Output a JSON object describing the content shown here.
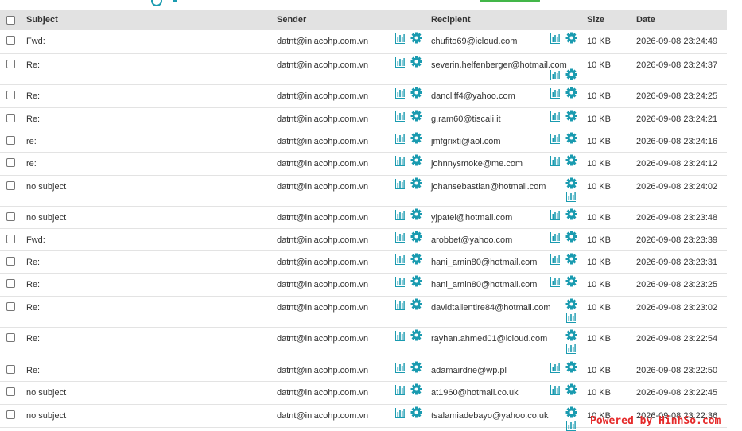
{
  "headers": {
    "subject": "Subject",
    "sender": "Sender",
    "recipient": "Recipient",
    "size": "Size",
    "date": "Date"
  },
  "colors": {
    "header_bg": "#e2e2e2",
    "icon_teal": "#1a9bb0",
    "accent_green": "#43b649",
    "watermark_red": "#e52a2a"
  },
  "rows": [
    {
      "subject": "Fwd:",
      "sender": "datnt@inlacohp.com.vn",
      "recipient": "chufito69@icloud.com",
      "size": "10 KB",
      "date": "2026-09-08 23:24:49"
    },
    {
      "subject": "Re:",
      "sender": "datnt@inlacohp.com.vn",
      "recipient": "severin.helfenberger@hotmail.com",
      "size": "10 KB",
      "date": "2026-09-08 23:24:37"
    },
    {
      "subject": "Re:",
      "sender": "datnt@inlacohp.com.vn",
      "recipient": "dancliff4@yahoo.com",
      "size": "10 KB",
      "date": "2026-09-08 23:24:25"
    },
    {
      "subject": "Re:",
      "sender": "datnt@inlacohp.com.vn",
      "recipient": "g.ram60@tiscali.it",
      "size": "10 KB",
      "date": "2026-09-08 23:24:21"
    },
    {
      "subject": "re:",
      "sender": "datnt@inlacohp.com.vn",
      "recipient": "jmfgrixti@aol.com",
      "size": "10 KB",
      "date": "2026-09-08 23:24:16"
    },
    {
      "subject": "re:",
      "sender": "datnt@inlacohp.com.vn",
      "recipient": "johnnysmoke@me.com",
      "size": "10 KB",
      "date": "2026-09-08 23:24:12"
    },
    {
      "subject": "no subject",
      "sender": "datnt@inlacohp.com.vn",
      "recipient": "johansebastian@hotmail.com",
      "size": "10 KB",
      "date": "2026-09-08 23:24:02"
    },
    {
      "subject": "no subject",
      "sender": "datnt@inlacohp.com.vn",
      "recipient": "yjpatel@hotmail.com",
      "size": "10 KB",
      "date": "2026-09-08 23:23:48"
    },
    {
      "subject": "Fwd:",
      "sender": "datnt@inlacohp.com.vn",
      "recipient": "arobbet@yahoo.com",
      "size": "10 KB",
      "date": "2026-09-08 23:23:39"
    },
    {
      "subject": "Re:",
      "sender": "datnt@inlacohp.com.vn",
      "recipient": "hani_amin80@hotmail.com",
      "size": "10 KB",
      "date": "2026-09-08 23:23:31"
    },
    {
      "subject": "Re:",
      "sender": "datnt@inlacohp.com.vn",
      "recipient": "hani_amin80@hotmail.com",
      "size": "10 KB",
      "date": "2026-09-08 23:23:25"
    },
    {
      "subject": "Re:",
      "sender": "datnt@inlacohp.com.vn",
      "recipient": "davidtallentire84@hotmail.com",
      "size": "10 KB",
      "date": "2026-09-08 23:23:02"
    },
    {
      "subject": "Re:",
      "sender": "datnt@inlacohp.com.vn",
      "recipient": "rayhan.ahmed01@icloud.com",
      "size": "10 KB",
      "date": "2026-09-08 23:22:54"
    },
    {
      "subject": "Re:",
      "sender": "datnt@inlacohp.com.vn",
      "recipient": "adamairdrie@wp.pl",
      "size": "10 KB",
      "date": "2026-09-08 23:22:50"
    },
    {
      "subject": "no subject",
      "sender": "datnt@inlacohp.com.vn",
      "recipient": "at1960@hotmail.co.uk",
      "size": "10 KB",
      "date": "2026-09-08 23:22:45"
    },
    {
      "subject": "no subject",
      "sender": "datnt@inlacohp.com.vn",
      "recipient": "tsalamiadebayo@yahoo.co.uk",
      "size": "10 KB",
      "date": "2026-09-08 23:22:36"
    }
  ],
  "watermark": "Powered by HinhSo.com"
}
